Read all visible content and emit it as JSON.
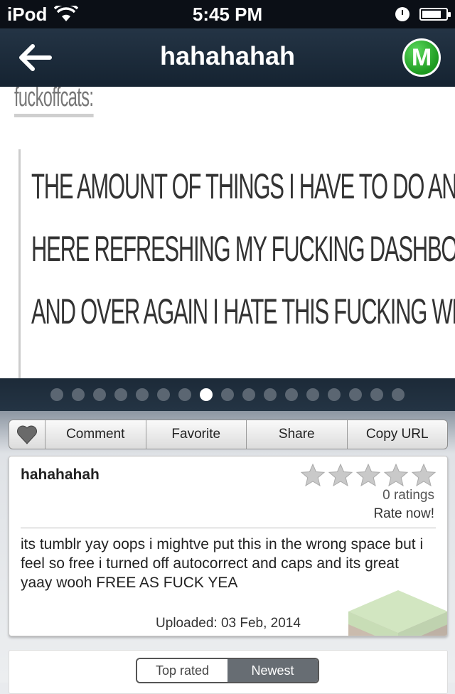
{
  "status_bar": {
    "carrier": "iPod",
    "time": "5:45 PM",
    "battery_level": 0.8
  },
  "nav": {
    "title": "hahahahah",
    "right_button_label": "M",
    "right_button_color": "#1d9a20"
  },
  "post_image": {
    "username": "fuckoffcats:",
    "quote_lines": [
      "THE AMOUNT OF THINGS I HAVE TO DO AND I'M SITTING",
      "HERE REFRESHING MY FUCKING DASHBOARD OVER",
      "AND OVER AGAIN I HATE THIS FUCKING WEBSITE"
    ]
  },
  "pagination": {
    "total": 17,
    "active_index": 7
  },
  "actions": {
    "comment": "Comment",
    "favorite": "Favorite",
    "share": "Share",
    "copy_url": "Copy URL"
  },
  "card": {
    "title": "hahahahah",
    "stars_total": 5,
    "ratings_count": "0 ratings",
    "rate_now": "Rate now!",
    "description": "its tumblr yay oops i mightve put this in the wrong space but i feel so free i turned off autocorrect and caps and its great yaay wooh FREE AS FUCK YEA",
    "uploaded": "Uploaded: 03 Feb, 2014"
  },
  "sort": {
    "top_rated": "Top rated",
    "newest": "Newest",
    "selected": "Newest"
  }
}
